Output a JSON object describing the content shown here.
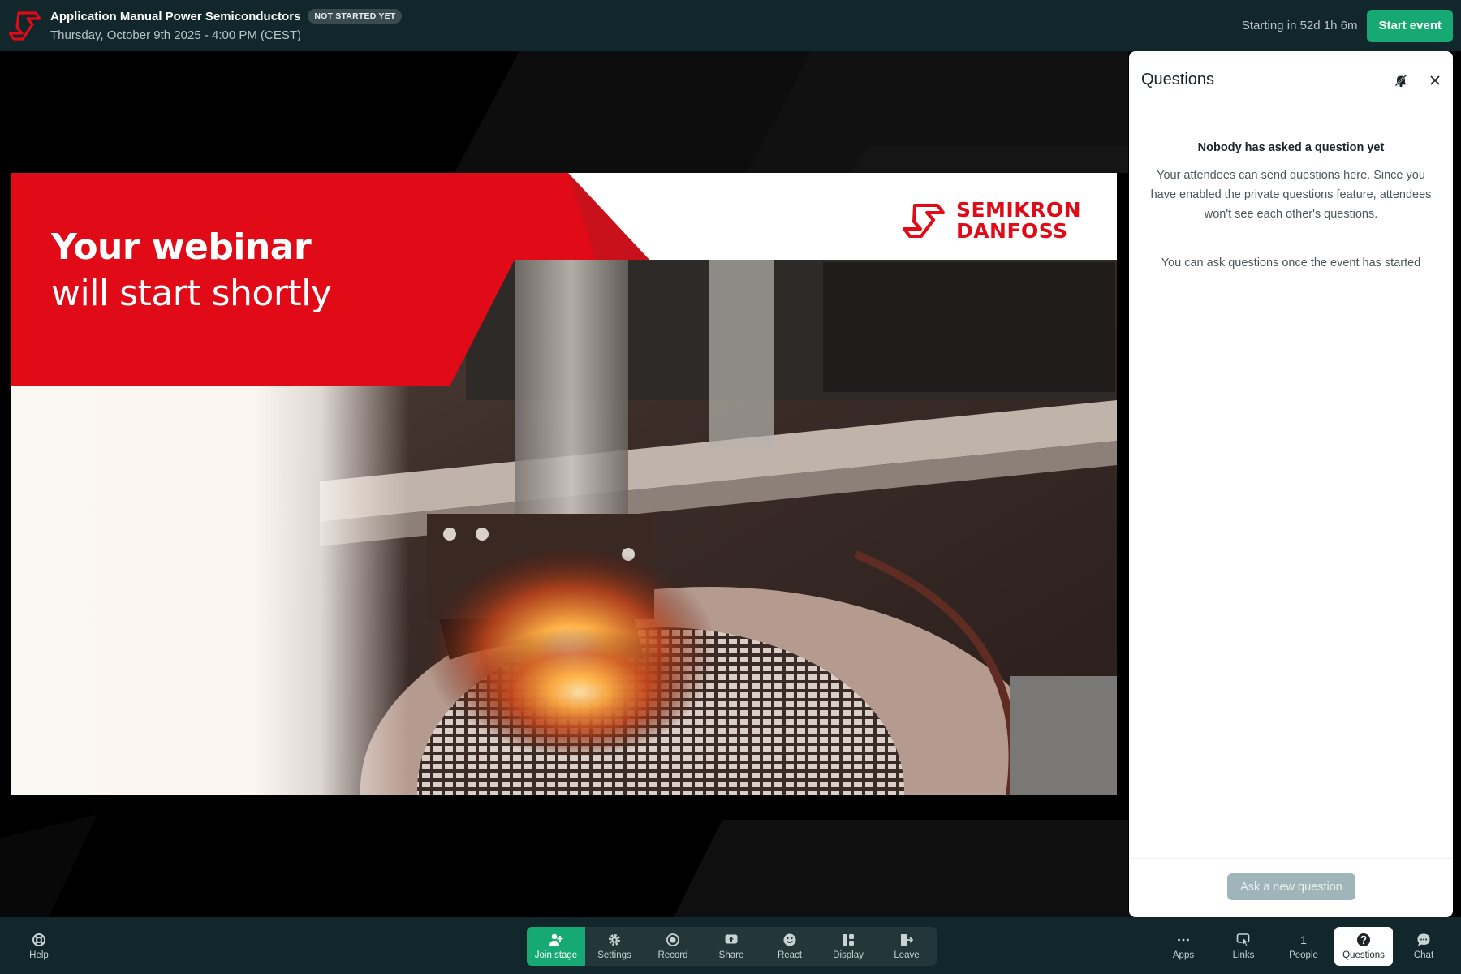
{
  "header": {
    "title": "Application Manual Power Semiconductors",
    "status_badge": "NOT STARTED YET",
    "date": "Thursday, October 9th 2025 - 4:00 PM (CEST)",
    "countdown": "Starting in 52d 1h 6m",
    "start_button": "Start event",
    "accent_color": "#17a974",
    "logo_color": "#e10a17"
  },
  "slide": {
    "headline_line1": "Your webinar",
    "headline_line2": "will start shortly",
    "brand_line1": "SEMIKRON",
    "brand_line2": "DANFOSS",
    "brand_color": "#e10a17"
  },
  "questions_panel": {
    "title": "Questions",
    "empty_title": "Nobody has asked a question yet",
    "empty_body": "Your attendees can send questions here. Since you have enabled the private questions feature, attendees won't see each other's questions.",
    "empty_note": "You can ask questions once the event has started",
    "ask_button": "Ask a new question",
    "mute_icon": "bell-off-icon",
    "close_icon": "close-icon"
  },
  "toolbar": {
    "help": "Help",
    "join_stage": "Join stage",
    "settings": "Settings",
    "record": "Record",
    "share": "Share",
    "react": "React",
    "display": "Display",
    "leave": "Leave",
    "apps": "Apps",
    "links": "Links",
    "people_count": "1",
    "people": "People",
    "questions": "Questions",
    "chat": "Chat"
  }
}
